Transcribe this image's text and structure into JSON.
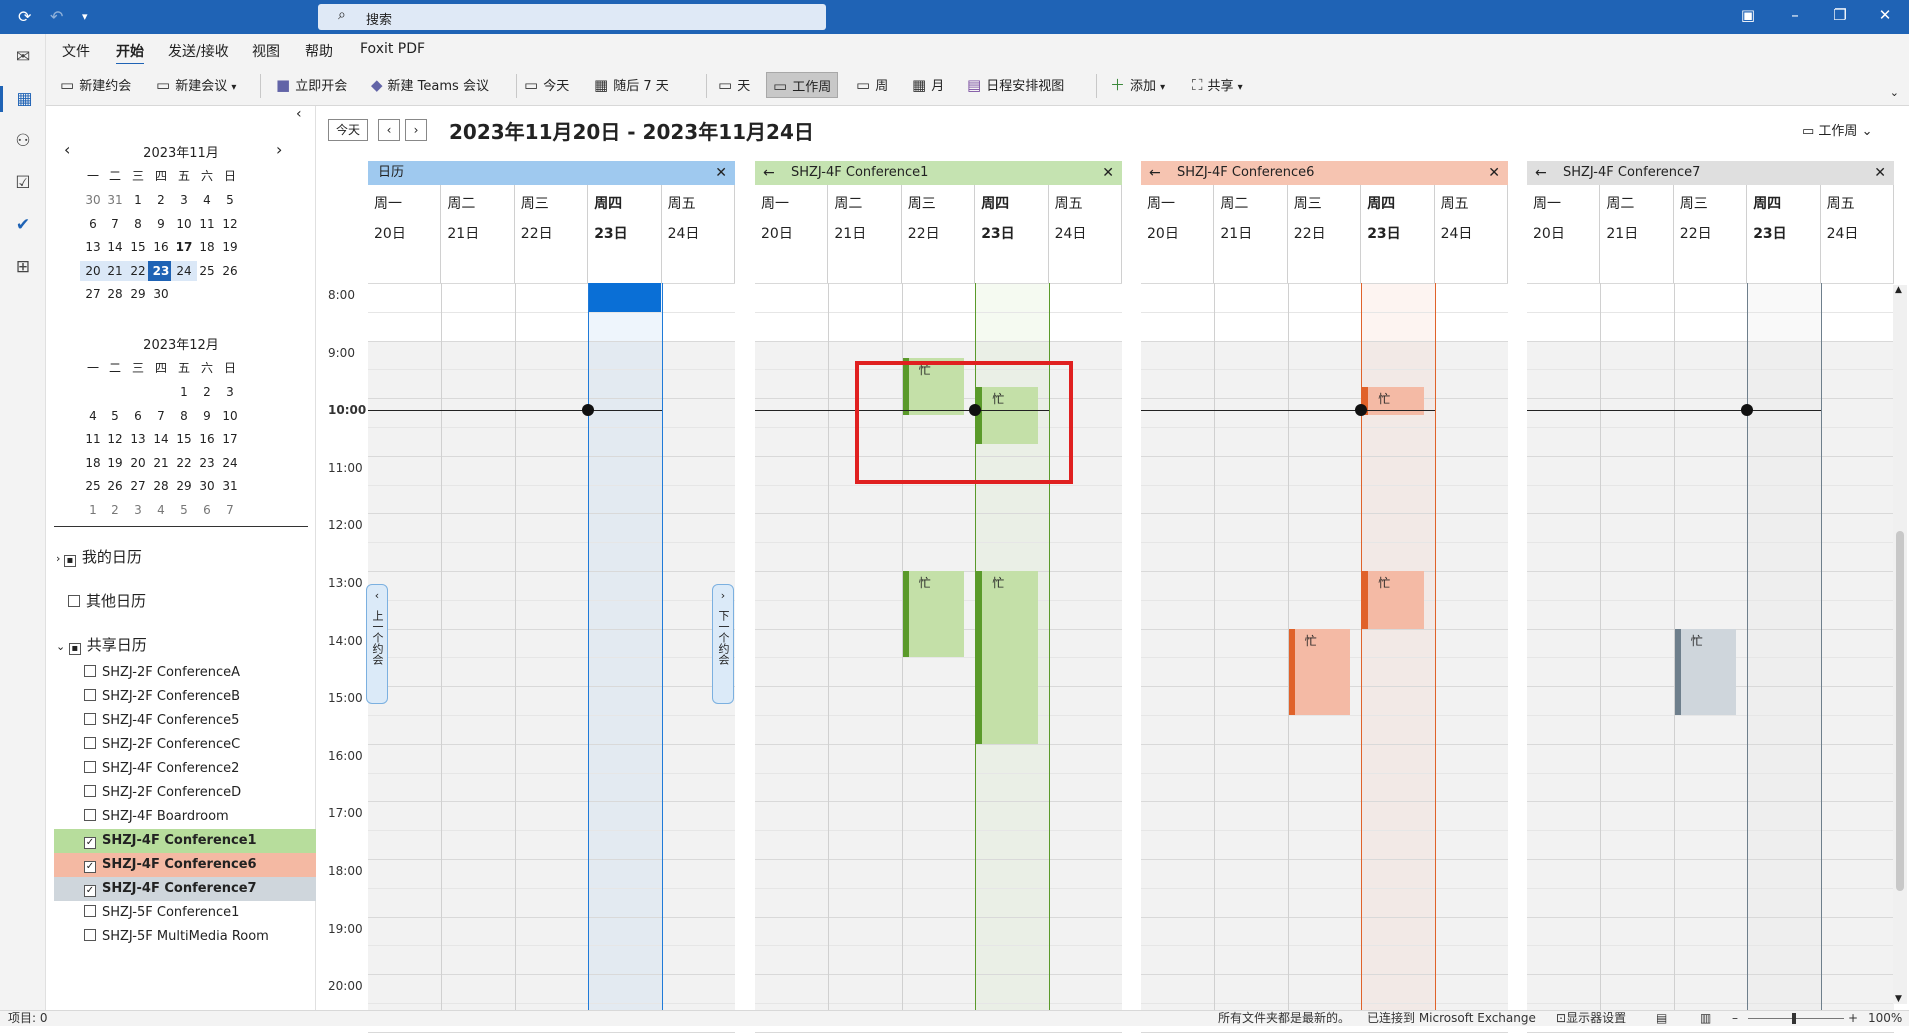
{
  "search": {
    "placeholder": "搜索"
  },
  "ribbon": {
    "tabs": [
      "文件",
      "开始",
      "发送/接收",
      "视图",
      "帮助",
      "Foxit PDF"
    ],
    "buttons": {
      "new_appointment": "新建约会",
      "new_meeting": "新建会议",
      "meet_now": "立即开会",
      "new_teams_meeting": "新建 Teams 会议",
      "today": "今天",
      "next7": "随后 7 天",
      "day": "天",
      "workweek": "工作周",
      "week": "周",
      "month": "月",
      "schedule_view": "日程安排视图",
      "add": "添加",
      "share": "共享"
    }
  },
  "mini_calendars": [
    {
      "title": "2023年11月",
      "weekdays": [
        "一",
        "二",
        "三",
        "四",
        "五",
        "六",
        "日"
      ],
      "rows": [
        [
          "30",
          "31",
          "1",
          "2",
          "3",
          "4",
          "5"
        ],
        [
          "6",
          "7",
          "8",
          "9",
          "10",
          "11",
          "12"
        ],
        [
          "13",
          "14",
          "15",
          "16",
          "17",
          "18",
          "19"
        ],
        [
          "20",
          "21",
          "22",
          "23",
          "24",
          "25",
          "26"
        ],
        [
          "27",
          "28",
          "29",
          "30",
          "",
          "",
          ""
        ]
      ]
    },
    {
      "title": "2023年12月",
      "weekdays": [
        "一",
        "二",
        "三",
        "四",
        "五",
        "六",
        "日"
      ],
      "rows": [
        [
          "",
          "",
          "",
          "",
          "1",
          "2",
          "3"
        ],
        [
          "4",
          "5",
          "6",
          "7",
          "8",
          "9",
          "10"
        ],
        [
          "11",
          "12",
          "13",
          "14",
          "15",
          "16",
          "17"
        ],
        [
          "18",
          "19",
          "20",
          "21",
          "22",
          "23",
          "24"
        ],
        [
          "25",
          "26",
          "27",
          "28",
          "29",
          "30",
          "31"
        ],
        [
          "1",
          "2",
          "3",
          "4",
          "5",
          "6",
          "7"
        ]
      ]
    }
  ],
  "folder_groups": {
    "my_calendars": "我的日历",
    "other_calendars": "其他日历",
    "shared_calendars": "共享日历"
  },
  "shared_items": [
    {
      "label": "SHZJ-2F ConferenceA",
      "checked": false,
      "color": ""
    },
    {
      "label": "SHZJ-2F ConferenceB",
      "checked": false,
      "color": ""
    },
    {
      "label": "SHZJ-4F Conference5",
      "checked": false,
      "color": ""
    },
    {
      "label": "SHZJ-2F ConferenceC",
      "checked": false,
      "color": ""
    },
    {
      "label": "SHZJ-4F Conference2",
      "checked": false,
      "color": ""
    },
    {
      "label": "SHZJ-2F ConferenceD",
      "checked": false,
      "color": ""
    },
    {
      "label": "SHZJ-4F Boardroom",
      "checked": false,
      "color": ""
    },
    {
      "label": "SHZJ-4F Conference1",
      "checked": true,
      "color": "#b7dd9c"
    },
    {
      "label": "SHZJ-4F Conference6",
      "checked": true,
      "color": "#f4b9a3"
    },
    {
      "label": "SHZJ-4F Conference7",
      "checked": true,
      "color": "#cfd6dc"
    },
    {
      "label": "SHZJ-5F Conference1",
      "checked": false,
      "color": ""
    },
    {
      "label": "SHZJ-5F MultiMedia Room",
      "checked": false,
      "color": ""
    }
  ],
  "main": {
    "today_btn": "今天",
    "date_range": "2023年11月20日 - 2023年11月24日",
    "view_selector": "工作周",
    "prev_appt": "上一个约会",
    "next_appt": "下一个约会"
  },
  "time_labels": [
    "8:00",
    "9:00",
    "10:00",
    "11:00",
    "12:00",
    "13:00",
    "14:00",
    "15:00",
    "16:00",
    "17:00",
    "18:00",
    "19:00",
    "20:00"
  ],
  "days": [
    {
      "weekday": "周一",
      "date": "20日"
    },
    {
      "weekday": "周二",
      "date": "21日"
    },
    {
      "weekday": "周三",
      "date": "22日"
    },
    {
      "weekday": "周四",
      "date": "23日"
    },
    {
      "weekday": "周五",
      "date": "24日"
    }
  ],
  "calendars": [
    {
      "name": "日历",
      "color": "#9fc9ef",
      "accent": "#1f7ad8",
      "busy_fill": "#0a6fd6",
      "has_back_arrow": false,
      "appointments": [
        {
          "day": 3,
          "start": 8.0,
          "end": 8.5,
          "label": ""
        }
      ]
    },
    {
      "name": "SHZJ-4F Conference1",
      "color": "#c5e3b1",
      "accent": "#5a9a2a",
      "busy_fill": "#c4e0a8",
      "has_back_arrow": true,
      "appointments": [
        {
          "day": 2,
          "start": 9.3,
          "end": 10.3,
          "label": "忙"
        },
        {
          "day": 3,
          "start": 9.8,
          "end": 10.8,
          "label": "忙"
        },
        {
          "day": 2,
          "start": 13.0,
          "end": 14.5,
          "label": "忙"
        },
        {
          "day": 3,
          "start": 13.0,
          "end": 16.0,
          "label": "忙"
        }
      ]
    },
    {
      "name": "SHZJ-4F Conference6",
      "color": "#f6c4b1",
      "accent": "#e0622a",
      "busy_fill": "#f4baa5",
      "has_back_arrow": true,
      "appointments": [
        {
          "day": 3,
          "start": 9.8,
          "end": 10.3,
          "label": "忙"
        },
        {
          "day": 3,
          "start": 13.0,
          "end": 14.0,
          "label": "忙"
        },
        {
          "day": 2,
          "start": 14.0,
          "end": 15.5,
          "label": "忙"
        }
      ]
    },
    {
      "name": "SHZJ-4F Conference7",
      "color": "#dfdfdf",
      "accent": "#6e7f8c",
      "busy_fill": "#cfd6dc",
      "has_back_arrow": true,
      "appointments": [
        {
          "day": 2,
          "start": 14.0,
          "end": 15.5,
          "label": "忙"
        }
      ]
    }
  ],
  "current_time": 10.2,
  "status": {
    "items": "项目: 0",
    "folders": "所有文件夹都是最新的。",
    "connection": "已连接到 Microsoft Exchange",
    "display": "显示器设置",
    "zoom": "100%"
  }
}
